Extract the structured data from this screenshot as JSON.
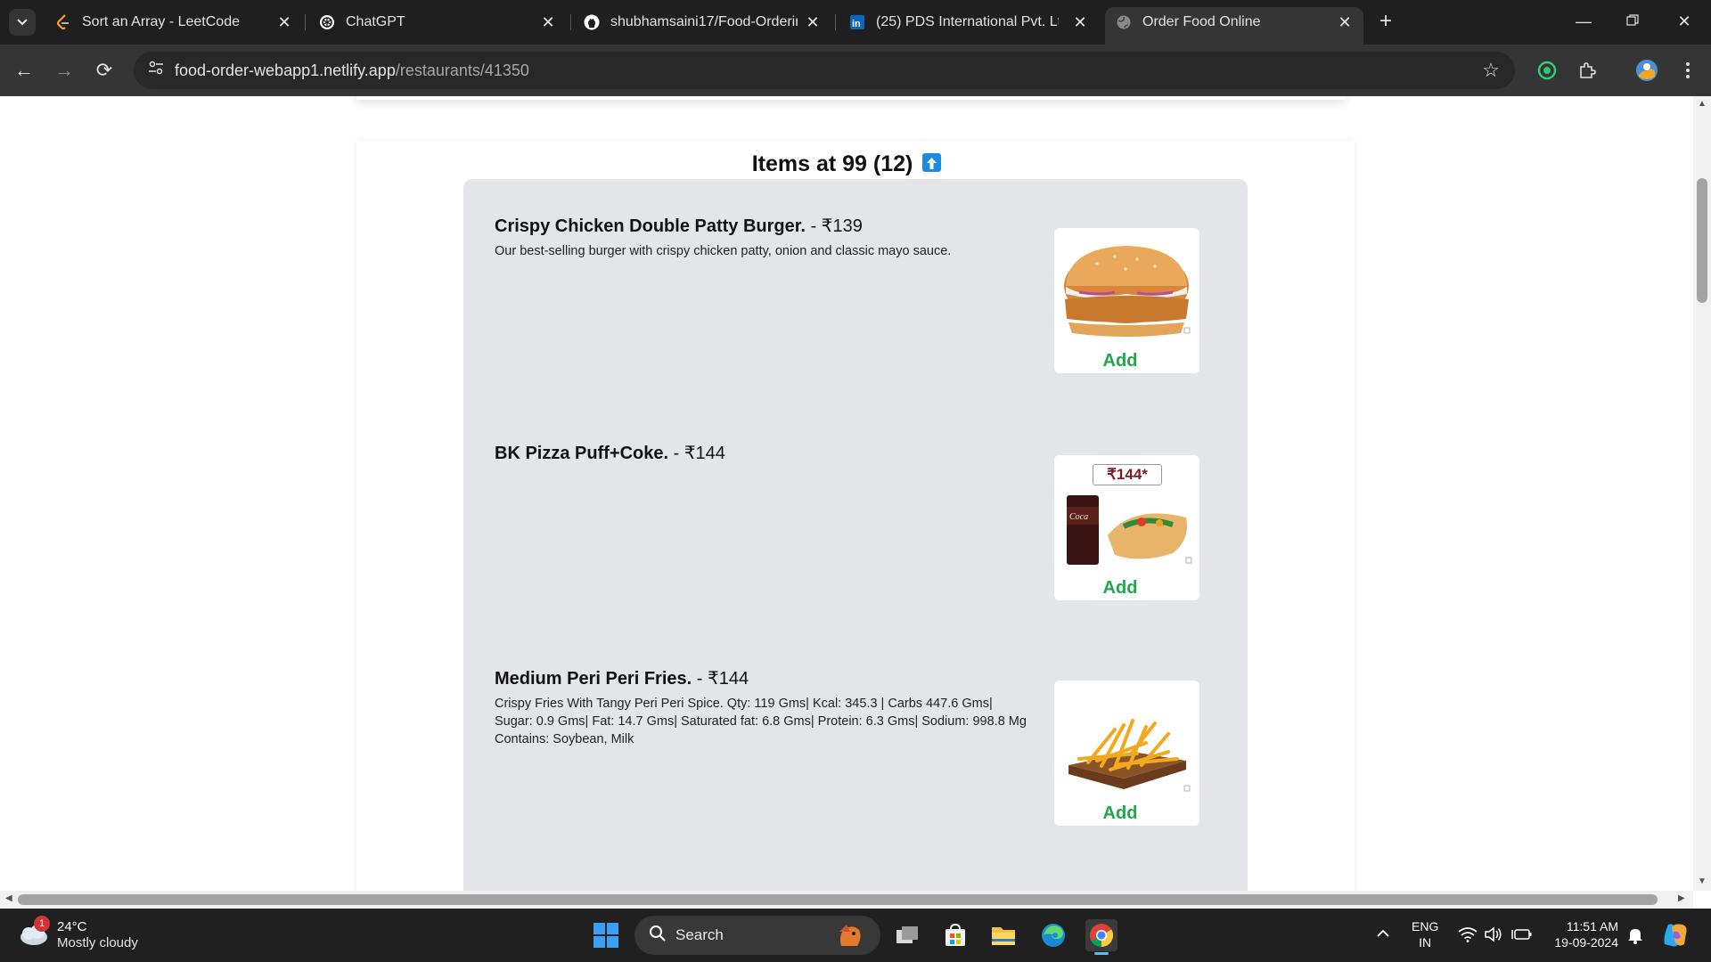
{
  "browser": {
    "tabs": [
      {
        "title": "Sort an Array - LeetCode",
        "icon": "leetcode-icon"
      },
      {
        "title": "ChatGPT",
        "icon": "chatgpt-icon"
      },
      {
        "title": "shubhamsaini17/Food-Ordering",
        "icon": "github-icon"
      },
      {
        "title": "(25) PDS International Pvt. Ltd.:",
        "icon": "linkedin-icon"
      },
      {
        "title": "Order Food Online",
        "icon": "globe-icon",
        "active": true
      }
    ],
    "url_host": "food-order-webapp1.netlify.app",
    "url_path": "/restaurants/41350"
  },
  "page": {
    "heading": "Items at 99 (12)",
    "items": [
      {
        "name": "Crispy Chicken Double Patty Burger.",
        "price": " - ₹139",
        "description": "Our best-selling burger with crispy chicken patty, onion and classic mayo sauce.",
        "image": "burger-image",
        "add_label": "Add"
      },
      {
        "name": "BK Pizza Puff+Coke.",
        "price": " - ₹144",
        "description": "",
        "image": "pizza-puff-coke-image",
        "image_badge": "₹144*",
        "add_label": "Add"
      },
      {
        "name": "Medium Peri Peri Fries.",
        "price": " - ₹144",
        "description": "Crispy Fries With Tangy Peri Peri Spice. Qty: 119 Gms| Kcal: 345.3 | Carbs 447.6 Gms| Sugar: 0.9 Gms| Fat: 14.7 Gms| Saturated fat: 6.8 Gms| Protein: 6.3 Gms| Sodium: 998.8 Mg Contains: Soybean, Milk",
        "image": "fries-image",
        "add_label": "Add"
      }
    ],
    "colors": {
      "add_text": "#1fa849",
      "panel_bg": "#e4e5e9",
      "up_icon": "#1e8ae0"
    }
  },
  "taskbar": {
    "weather_badge": "1",
    "weather_temp": "24°C",
    "weather_desc": "Mostly cloudy",
    "search_label": "Search",
    "lang_line1": "ENG",
    "lang_line2": "IN",
    "time": "11:51 AM",
    "date": "19-09-2024"
  }
}
